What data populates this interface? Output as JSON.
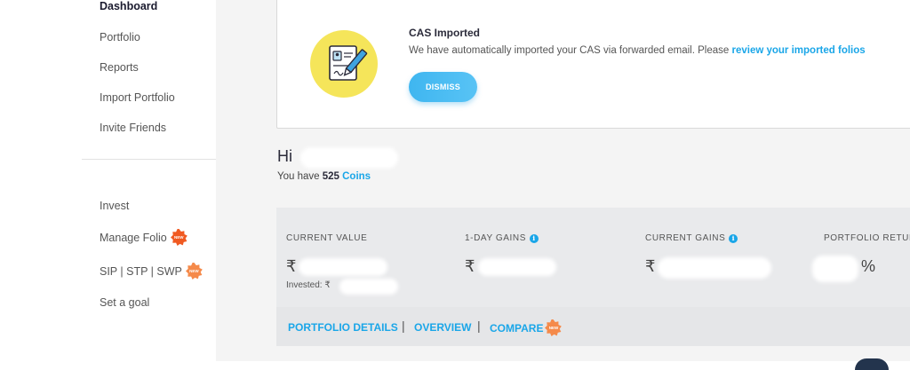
{
  "sidebar": {
    "items": [
      {
        "label": "Dashboard",
        "active": true
      },
      {
        "label": "Portfolio"
      },
      {
        "label": "Reports"
      },
      {
        "label": "Import Portfolio"
      },
      {
        "label": "Invite Friends"
      }
    ],
    "secondary_items": [
      {
        "label": "Invest"
      },
      {
        "label": "Manage Folio",
        "badge": "NEW"
      },
      {
        "label": "SIP | STP | SWP",
        "badge": "NEW"
      },
      {
        "label": "Set a goal"
      }
    ]
  },
  "cas_banner": {
    "title": "CAS Imported",
    "message": "We have automatically imported your CAS via forwarded email. Please ",
    "link_text": "review your imported folios",
    "dismiss_label": "DISMISS"
  },
  "greeting": {
    "hi": "Hi",
    "coins_prefix": "You have ",
    "coins_count": "525",
    "coins_label": "Coins"
  },
  "stats": {
    "current_value_label": "CURRENT VALUE",
    "one_day_gains_label": "1-DAY GAINS",
    "current_gains_label": "CURRENT GAINS",
    "portfolio_returns_label": "PORTFOLIO RETURNS",
    "currency": "₹",
    "invested_label": "Invested: ₹",
    "percent_symbol": "%"
  },
  "actions": {
    "portfolio_details": "PORTFOLIO DETAILS",
    "overview": "OVERVIEW",
    "compare": "COMPARE",
    "separator": "|",
    "badge": "NEW"
  },
  "colors": {
    "accent": "#1aa6e8",
    "badge": "#f05a22",
    "badge_light": "#f58a4a"
  }
}
